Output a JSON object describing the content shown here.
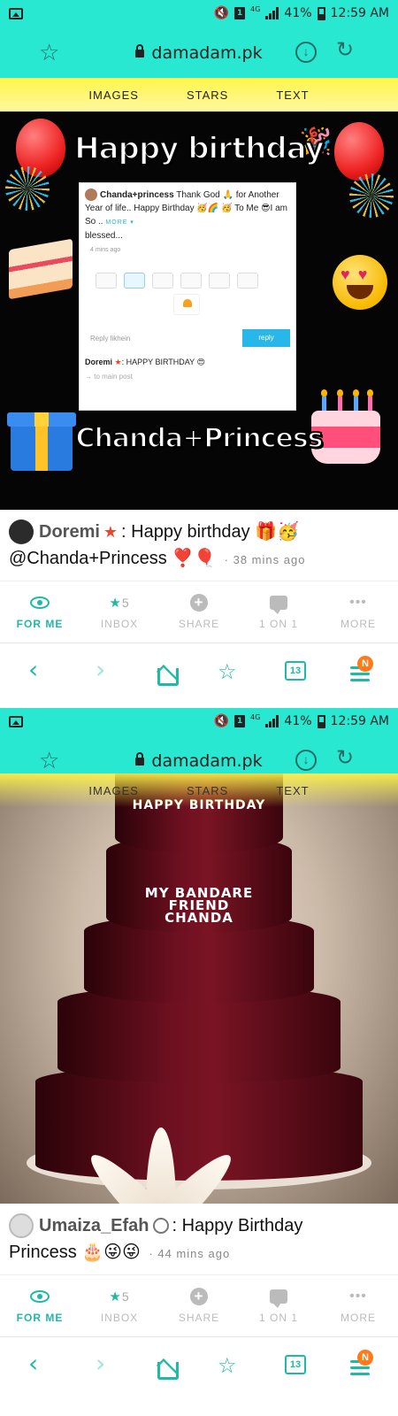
{
  "status_bar": {
    "signal_label": "4G",
    "battery": "41%",
    "time": "12:59 AM"
  },
  "browser": {
    "url": "damadam.pk"
  },
  "site_nav": {
    "items": [
      "IMAGES",
      "STARS",
      "TEXT"
    ]
  },
  "posts": [
    {
      "image": {
        "headline": "Happy birthday",
        "name_banner": "Chanda+Princess",
        "card": {
          "author": "Chanda+princess",
          "text": "Thank God 🙏 for Another Year of life.. Happy Birthday 🥳🌈 🥳 To Me 😎I am So ..",
          "more": "MORE ▾",
          "text_tail": "blessed...",
          "ago": "4 mins ago",
          "reply_placeholder": "Reply likhein",
          "reply_button": "reply",
          "reply_author": "Doremi",
          "reply_text": ": HAPPY BIRTHDAY 😍",
          "to_main": "→ to main post"
        }
      },
      "author": "Doremi",
      "badge": "★",
      "message": ": Happy birthday 🎁🥳",
      "message_line2": "@Chanda+Princess",
      "hearts": "❣️🎈",
      "time": "· 38 mins ago"
    },
    {
      "image": {
        "line1": "HAPPY BIRTHDAY",
        "line2": "MY BANDARE",
        "line3": "FRIEND",
        "line4": "CHANDA"
      },
      "author": "Umaiza_Efah",
      "badge": "🕓",
      "message": ": Happy Birthday",
      "message_line2": "Princess 🎂😜😜",
      "time": "· 44 mins ago"
    }
  ],
  "action_bar": {
    "for_me": "FOR ME",
    "inbox_count": "5",
    "inbox": "INBOX",
    "share": "SHARE",
    "one_on_one": "1 ON 1",
    "more": "MORE"
  },
  "bottom_nav": {
    "tabs_count": "13",
    "badge": "N"
  },
  "colors": {
    "teal": "#29e8d2",
    "accent": "#1fb9a7",
    "yellow": "#fff54a"
  }
}
